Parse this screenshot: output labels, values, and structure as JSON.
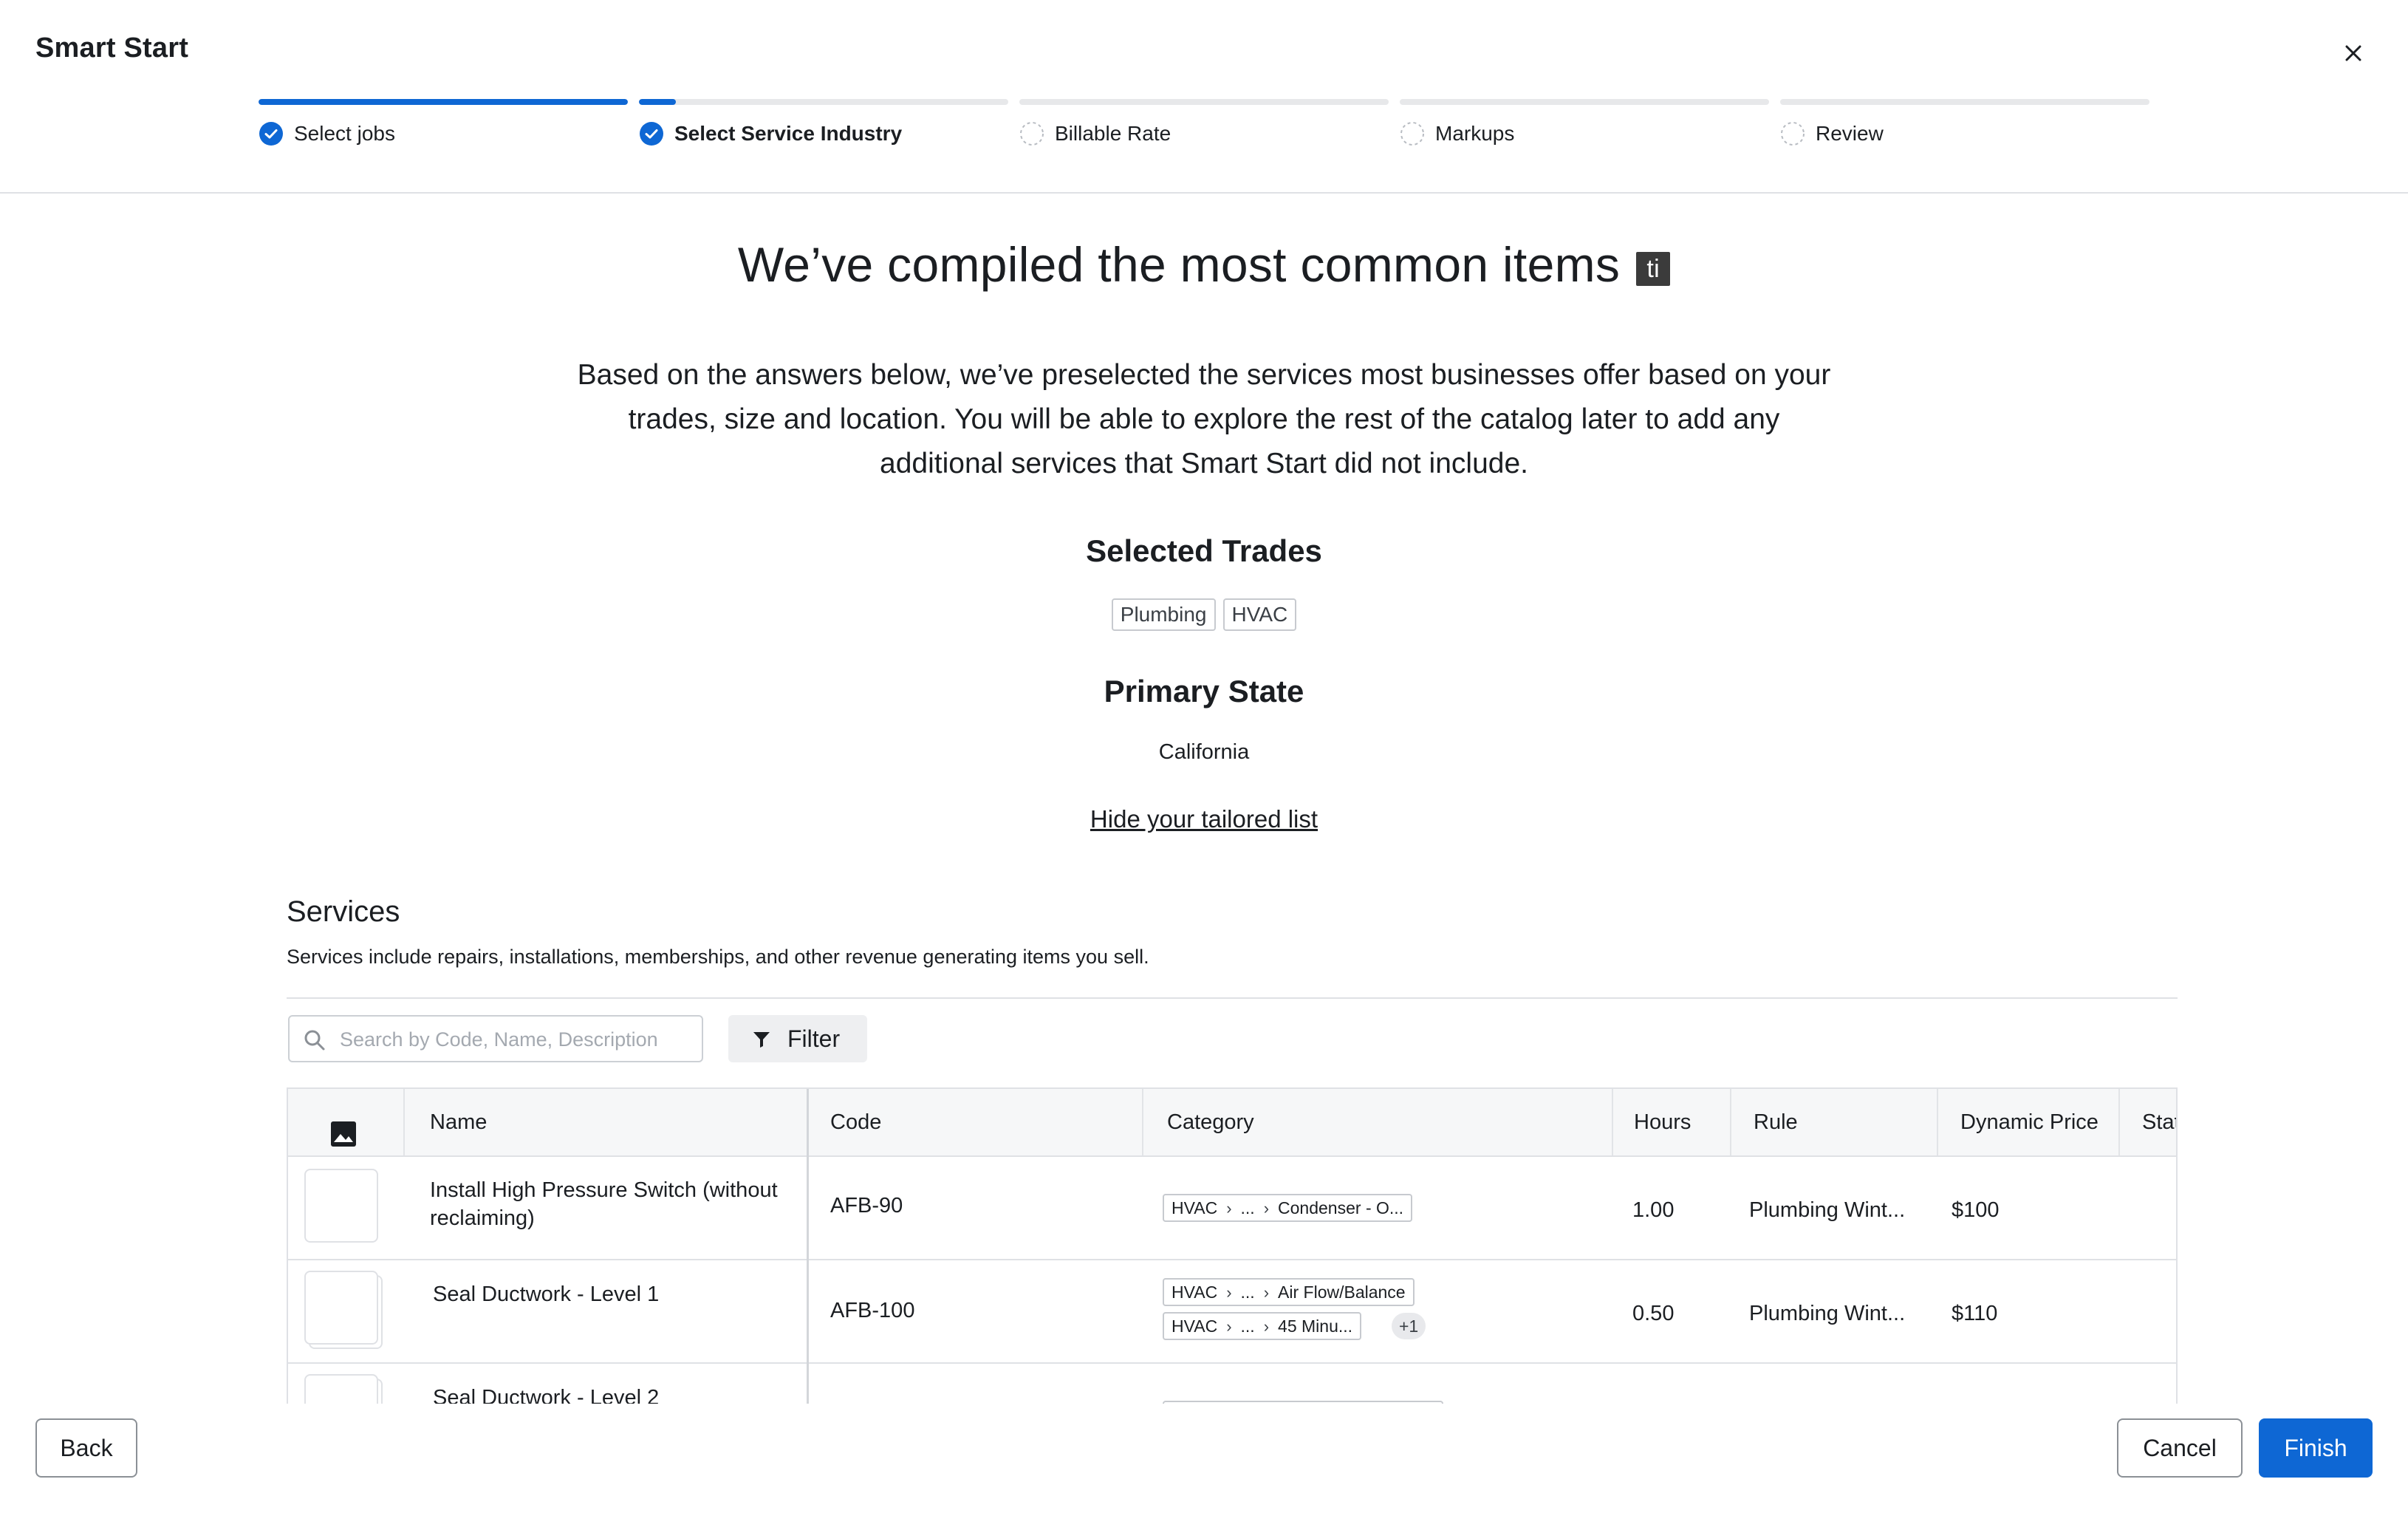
{
  "app": {
    "title": "Smart Start"
  },
  "stepper": {
    "steps": [
      {
        "label": "Select jobs",
        "status": "complete",
        "progress": 1.0
      },
      {
        "label": "Select Service Industry",
        "status": "current",
        "progress": 0.1
      },
      {
        "label": "Billable Rate",
        "status": "pending",
        "progress": 0
      },
      {
        "label": "Markups",
        "status": "pending",
        "progress": 0
      },
      {
        "label": "Review",
        "status": "pending",
        "progress": 0
      }
    ]
  },
  "intro": {
    "headline": "We’ve compiled the most common items",
    "badge": "ti",
    "description": "Based on the answers below, we’ve preselected the services most businesses offer based on your trades, size and location. You will be able to explore the rest of the catalog later to add any additional services that Smart Start did not include."
  },
  "trades": {
    "title": "Selected Trades",
    "items": [
      "Plumbing",
      "HVAC"
    ]
  },
  "state": {
    "title": "Primary State",
    "value": "California"
  },
  "hide_link": "Hide your tailored list",
  "services": {
    "title": "Services",
    "description": "Services include repairs, installations, memberships, and other revenue generating items you sell.",
    "search_placeholder": "Search by Code, Name, Description",
    "filter_label": "Filter",
    "columns": {
      "image": "image-icon",
      "name": "Name",
      "code": "Code",
      "category": "Category",
      "hours": "Hours",
      "rule": "Rule",
      "dynamic_price": "Dynamic Price",
      "status": "Stat"
    },
    "rows": [
      {
        "name": "Install High Pressure Switch (without reclaiming)",
        "code": "AFB-90",
        "categories": [
          {
            "root": "HVAC",
            "mid": "...",
            "leaf": "Condenser - O..."
          }
        ],
        "more": "",
        "hours": "1.00",
        "rule": "Plumbing Wint...",
        "price": "$100"
      },
      {
        "name": "Seal Ductwork - Level 1",
        "code": "AFB-100",
        "categories": [
          {
            "root": "HVAC",
            "mid": "...",
            "leaf": "Air Flow/Balance"
          },
          {
            "root": "HVAC",
            "mid": "...",
            "leaf": "45 Minu..."
          }
        ],
        "more": "+1",
        "hours": "0.50",
        "rule": "Plumbing Wint...",
        "price": "$110"
      },
      {
        "name": "Seal Ductwork - Level 2",
        "code": "",
        "categories": [],
        "more": "",
        "hours": "",
        "rule": "",
        "price": ""
      }
    ]
  },
  "footer": {
    "back": "Back",
    "cancel": "Cancel",
    "finish": "Finish"
  },
  "colors": {
    "primary": "#0e67d4",
    "border": "#dfe1e5",
    "text": "#1b1e22"
  }
}
